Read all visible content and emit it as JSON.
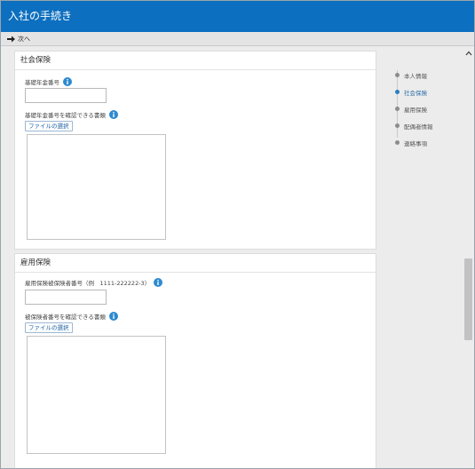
{
  "app": {
    "title": "入社の手続き"
  },
  "toolbar": {
    "next_label": "次へ"
  },
  "sections": {
    "social_insurance": {
      "title": "社会保険",
      "pension_number_label": "基礎年金番号",
      "pension_number_value": "",
      "pension_doc_label": "基礎年金番号を確認できる書類",
      "file_button": "ファイルの選択"
    },
    "employment_insurance": {
      "title": "雇用保険",
      "insured_number_label": "雇用保険被保険者番号（例　1111-222222-3）",
      "insured_number_value": "",
      "insured_doc_label": "被保険者番号を確認できる書類",
      "file_button": "ファイルの選択"
    }
  },
  "stepper": {
    "steps": [
      {
        "label": "本人情報",
        "active": false
      },
      {
        "label": "社会保険",
        "active": true
      },
      {
        "label": "雇用保険",
        "active": false
      },
      {
        "label": "配偶者情報",
        "active": false
      },
      {
        "label": "連絡事項",
        "active": false
      }
    ]
  },
  "colors": {
    "header_bg": "#0d6fbf",
    "accent": "#2d7dc2",
    "info_icon": "#2d8ad0"
  },
  "icons": {
    "next": "arrow-right-icon",
    "info": "info-icon",
    "scroll_up": "chevron-up-icon"
  }
}
